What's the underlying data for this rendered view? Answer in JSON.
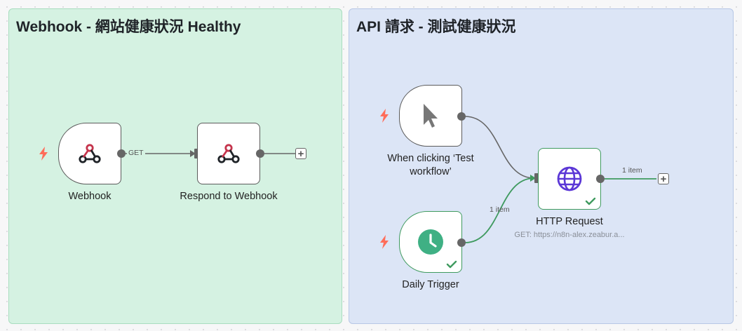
{
  "groups": {
    "webhook_title": "Webhook - 網站健康狀況 Healthy",
    "api_title": "API 請求 - 測試健康狀況"
  },
  "nodes": {
    "webhook": {
      "label": "Webhook",
      "icon": "webhook-icon"
    },
    "respond": {
      "label": "Respond to Webhook",
      "icon": "webhook-icon"
    },
    "manual": {
      "label_line1": "When clicking ‘Test",
      "label_line2": "workflow’",
      "icon": "cursor-pointer-icon"
    },
    "schedule": {
      "label": "Daily Trigger",
      "icon": "clock-icon"
    },
    "http": {
      "label": "HTTP Request",
      "sub": "GET: https://n8n-alex.zeabur.a...",
      "icon": "globe-icon"
    }
  },
  "edges": {
    "get_label": "GET",
    "schedule_items": "1 item",
    "http_items": "1 item"
  },
  "colors": {
    "trigger_bolt": "#ff6d5a",
    "success": "#3f9a5f",
    "globe": "#5b37d6",
    "clock": "#3fb084",
    "webhook_red": "#c5344c"
  }
}
